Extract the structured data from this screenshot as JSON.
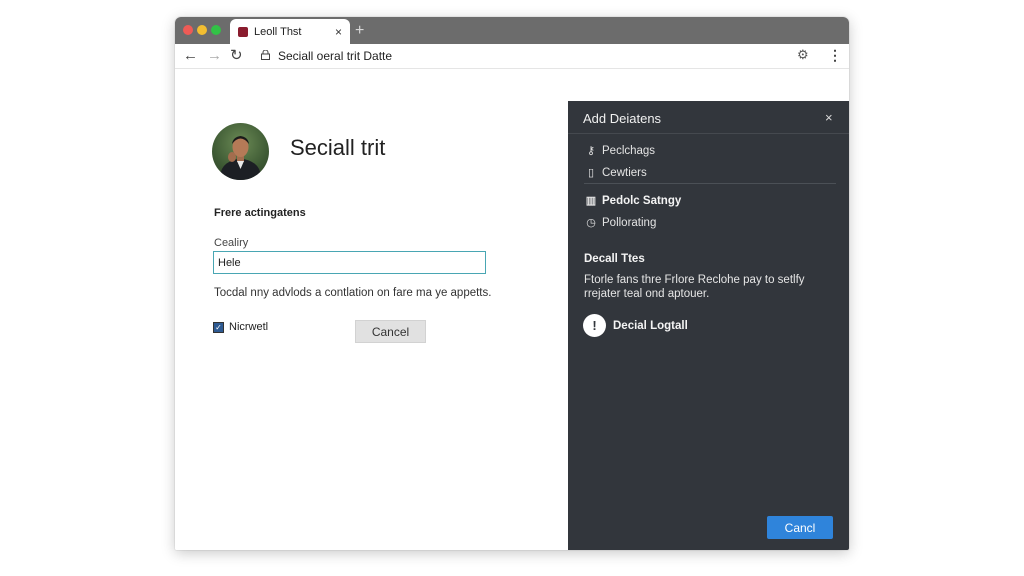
{
  "browser": {
    "tab_title": "Leoll Thst",
    "tab_close": "×",
    "new_tab": "+",
    "url": "Seciall oeral trit Datte",
    "nav": {
      "back": "←",
      "forward": "→",
      "reload": "↻"
    },
    "toolbar_icons": {
      "extension": "⚙",
      "menu": "⋮"
    }
  },
  "page": {
    "title": "Seciall trit",
    "section_label": "Frere actingatens",
    "field_label": "Cealiry",
    "field_value": "Hele",
    "help_text": "Tocdal nny advlods a contlation on fare ma ye appetts.",
    "checkbox_label": "Nicrwetl",
    "checkbox_checked": true,
    "cancel_label": "Cancel"
  },
  "panel": {
    "title": "Add Deiatens",
    "close": "×",
    "items": [
      {
        "icon": "key-icon",
        "glyph": "⚷",
        "label": "Peclchags",
        "bold": false
      },
      {
        "icon": "clipboard-icon",
        "glyph": "▯",
        "label": "Cewtiers",
        "bold": false
      },
      {
        "icon": "book-icon",
        "glyph": "▥",
        "label": "Pedolc Satngy",
        "bold": true
      },
      {
        "icon": "clock-icon",
        "glyph": "◷",
        "label": "Pollorating",
        "bold": false
      }
    ],
    "section_title": "Decall Ttes",
    "description": "Ftorle fans thre Frlore Reclohe pay to setlfy rrejater teal ond aptouer.",
    "alert_label": "Decial Logtall",
    "alert_glyph": "!",
    "primary_label": "Cancl"
  },
  "colors": {
    "panel_bg": "#32363c",
    "primary_button": "#2f84db",
    "input_border": "#49a6b3",
    "titlebar": "#6c6c6c"
  }
}
